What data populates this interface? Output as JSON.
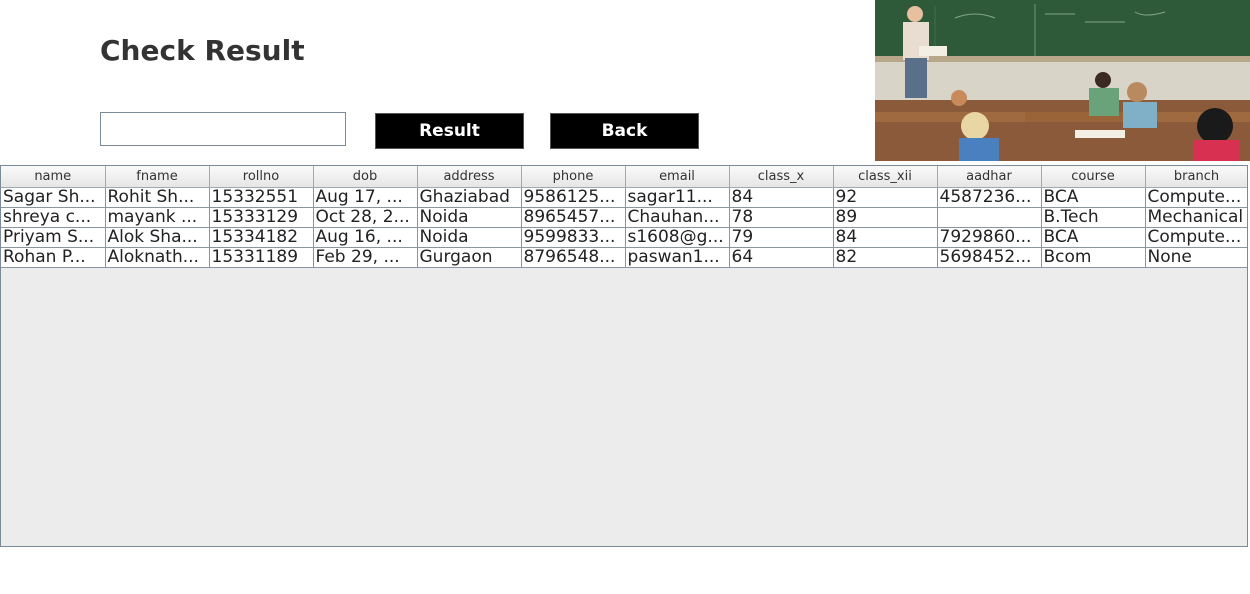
{
  "page": {
    "title": "Check Result"
  },
  "search": {
    "value": "",
    "placeholder": ""
  },
  "buttons": {
    "result_label": "Result",
    "back_label": "Back"
  },
  "photo": {
    "description_icon": "classroom-photo"
  },
  "table": {
    "columns": [
      "name",
      "fname",
      "rollno",
      "dob",
      "address",
      "phone",
      "email",
      "class_x",
      "class_xii",
      "aadhar",
      "course",
      "branch"
    ],
    "rows": [
      [
        "Sagar Sh...",
        "Rohit Sh...",
        "15332551",
        "Aug 17, ...",
        "Ghaziabad",
        "9586125...",
        "sagar11...",
        "84",
        "92",
        "4587236...",
        "BCA",
        "Compute..."
      ],
      [
        "shreya c...",
        "mayank ...",
        "15333129",
        "Oct 28, 2...",
        "Noida",
        "8965457...",
        "Chauhan...",
        "78",
        "89",
        "",
        "B.Tech",
        "Mechanical"
      ],
      [
        "Priyam S...",
        "Alok Sha...",
        "15334182",
        "Aug 16, ...",
        "Noida",
        "9599833...",
        "s1608@g...",
        "79",
        "84",
        "7929860...",
        "BCA",
        "Compute..."
      ],
      [
        "Rohan P...",
        "Aloknath...",
        "15331189",
        "Feb 29, ...",
        "Gurgaon",
        "8796548...",
        "paswan1...",
        "64",
        "82",
        "5698452...",
        "Bcom",
        "None"
      ]
    ]
  },
  "colors": {
    "button_bg": "#000000",
    "button_text": "#ffffff",
    "table_bg": "#ececec"
  }
}
